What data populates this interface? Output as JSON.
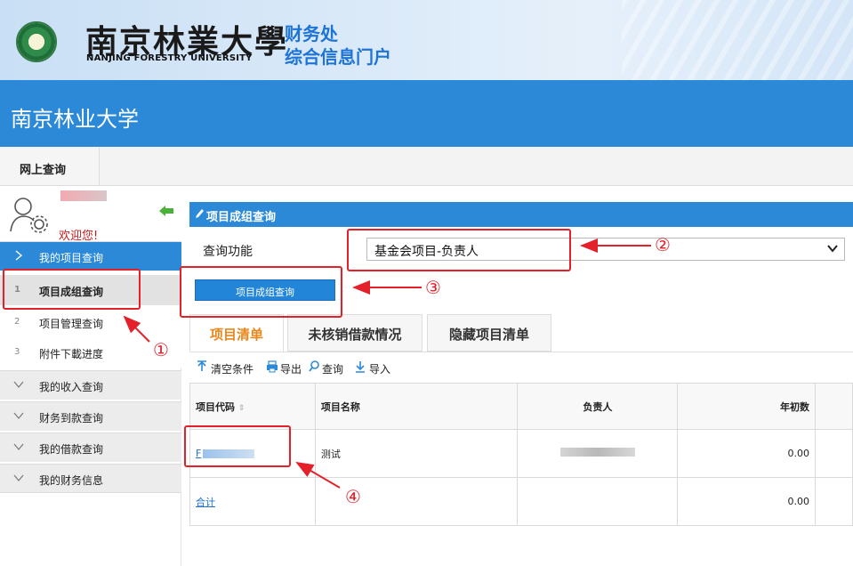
{
  "banner": {
    "university_cn": "南京林業大學",
    "university_en": "NANJING FORESTRY UNIVERSITY",
    "dept_line1": "财务处",
    "dept_line2": "综合信息门户"
  },
  "header": {
    "title": "南京林业大学"
  },
  "topnav": {
    "tab": "网上查询"
  },
  "user": {
    "welcome": "欢迎您!"
  },
  "sidebar": {
    "sections": [
      {
        "label": "我的项目查询",
        "active": true
      },
      {
        "label": "我的收入查询"
      },
      {
        "label": "财务到款查询"
      },
      {
        "label": "我的借款查询"
      },
      {
        "label": "我的财务信息"
      }
    ],
    "items": [
      {
        "num": "1",
        "label": "项目成组查询",
        "selected": true
      },
      {
        "num": "2",
        "label": "项目管理查询"
      },
      {
        "num": "3",
        "label": "附件下載进度"
      }
    ]
  },
  "panel": {
    "title": "项目成组查询",
    "func_label": "查询功能",
    "func_value": "基金会项目-负责人",
    "query_button": "项目成组查询"
  },
  "tabs": [
    {
      "label": "项目清单",
      "active": true
    },
    {
      "label": "未核销借款情况"
    },
    {
      "label": "隐藏项目清单"
    }
  ],
  "toolbar": {
    "clear": "清空条件",
    "export": "导出",
    "query": "查询",
    "import": "导入"
  },
  "table": {
    "headers": [
      "项目代码",
      "项目名称",
      "负责人",
      "年初数"
    ],
    "rows": [
      {
        "code": "F",
        "name": "测试",
        "year_start": "0.00"
      },
      {
        "code": "合计",
        "name": "",
        "year_start": "0.00"
      }
    ]
  },
  "annotations": [
    "①",
    "②",
    "③",
    "④"
  ],
  "colors": {
    "primary": "#2b89d8",
    "accent_orange": "#e8871b",
    "annotation_red": "#e4202a",
    "welcome_red": "#c41a1a"
  }
}
